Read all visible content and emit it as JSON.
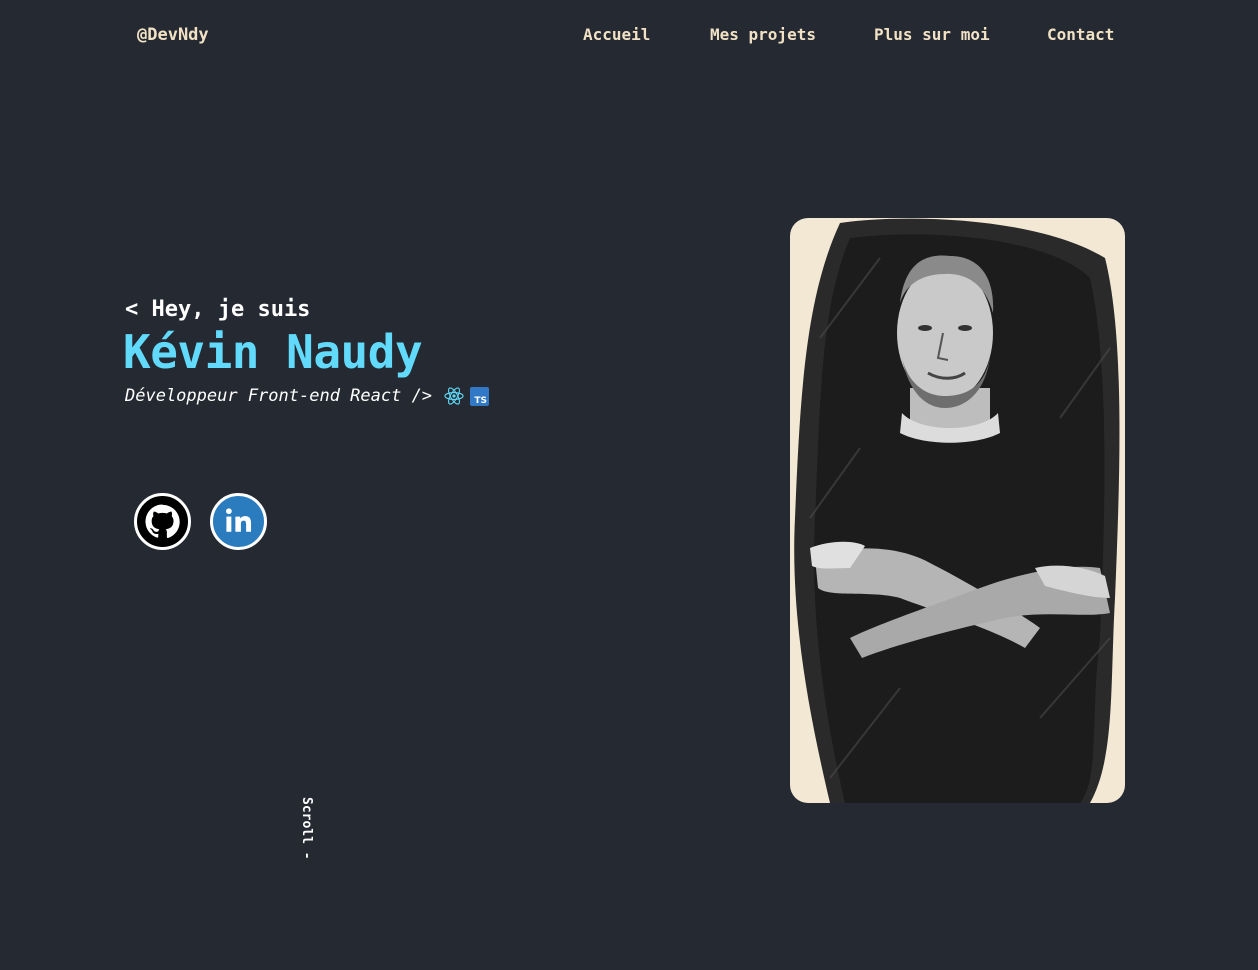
{
  "header": {
    "brand": "@DevNdy",
    "nav": [
      "Accueil",
      "Mes projets",
      "Plus sur moi",
      "Contact"
    ]
  },
  "hero": {
    "greeting": "< Hey, je suis",
    "name": "Kévin Naudy",
    "role": "Développeur Front-end React />",
    "tech_icons": [
      "react-icon",
      "typescript-icon"
    ],
    "ts_badge": "TS"
  },
  "social": [
    {
      "icon": "github-icon"
    },
    {
      "icon": "linkedin-icon"
    }
  ],
  "scroll_label": "Scroll -",
  "portrait": {
    "icon": "profile-portrait"
  },
  "colors": {
    "background": "#252932",
    "nav_text": "#f1e2c5",
    "accent": "#61dafb",
    "text": "#ffffff",
    "linkedin": "#2b7bbf",
    "portrait_bg": "#f3e8d4"
  }
}
